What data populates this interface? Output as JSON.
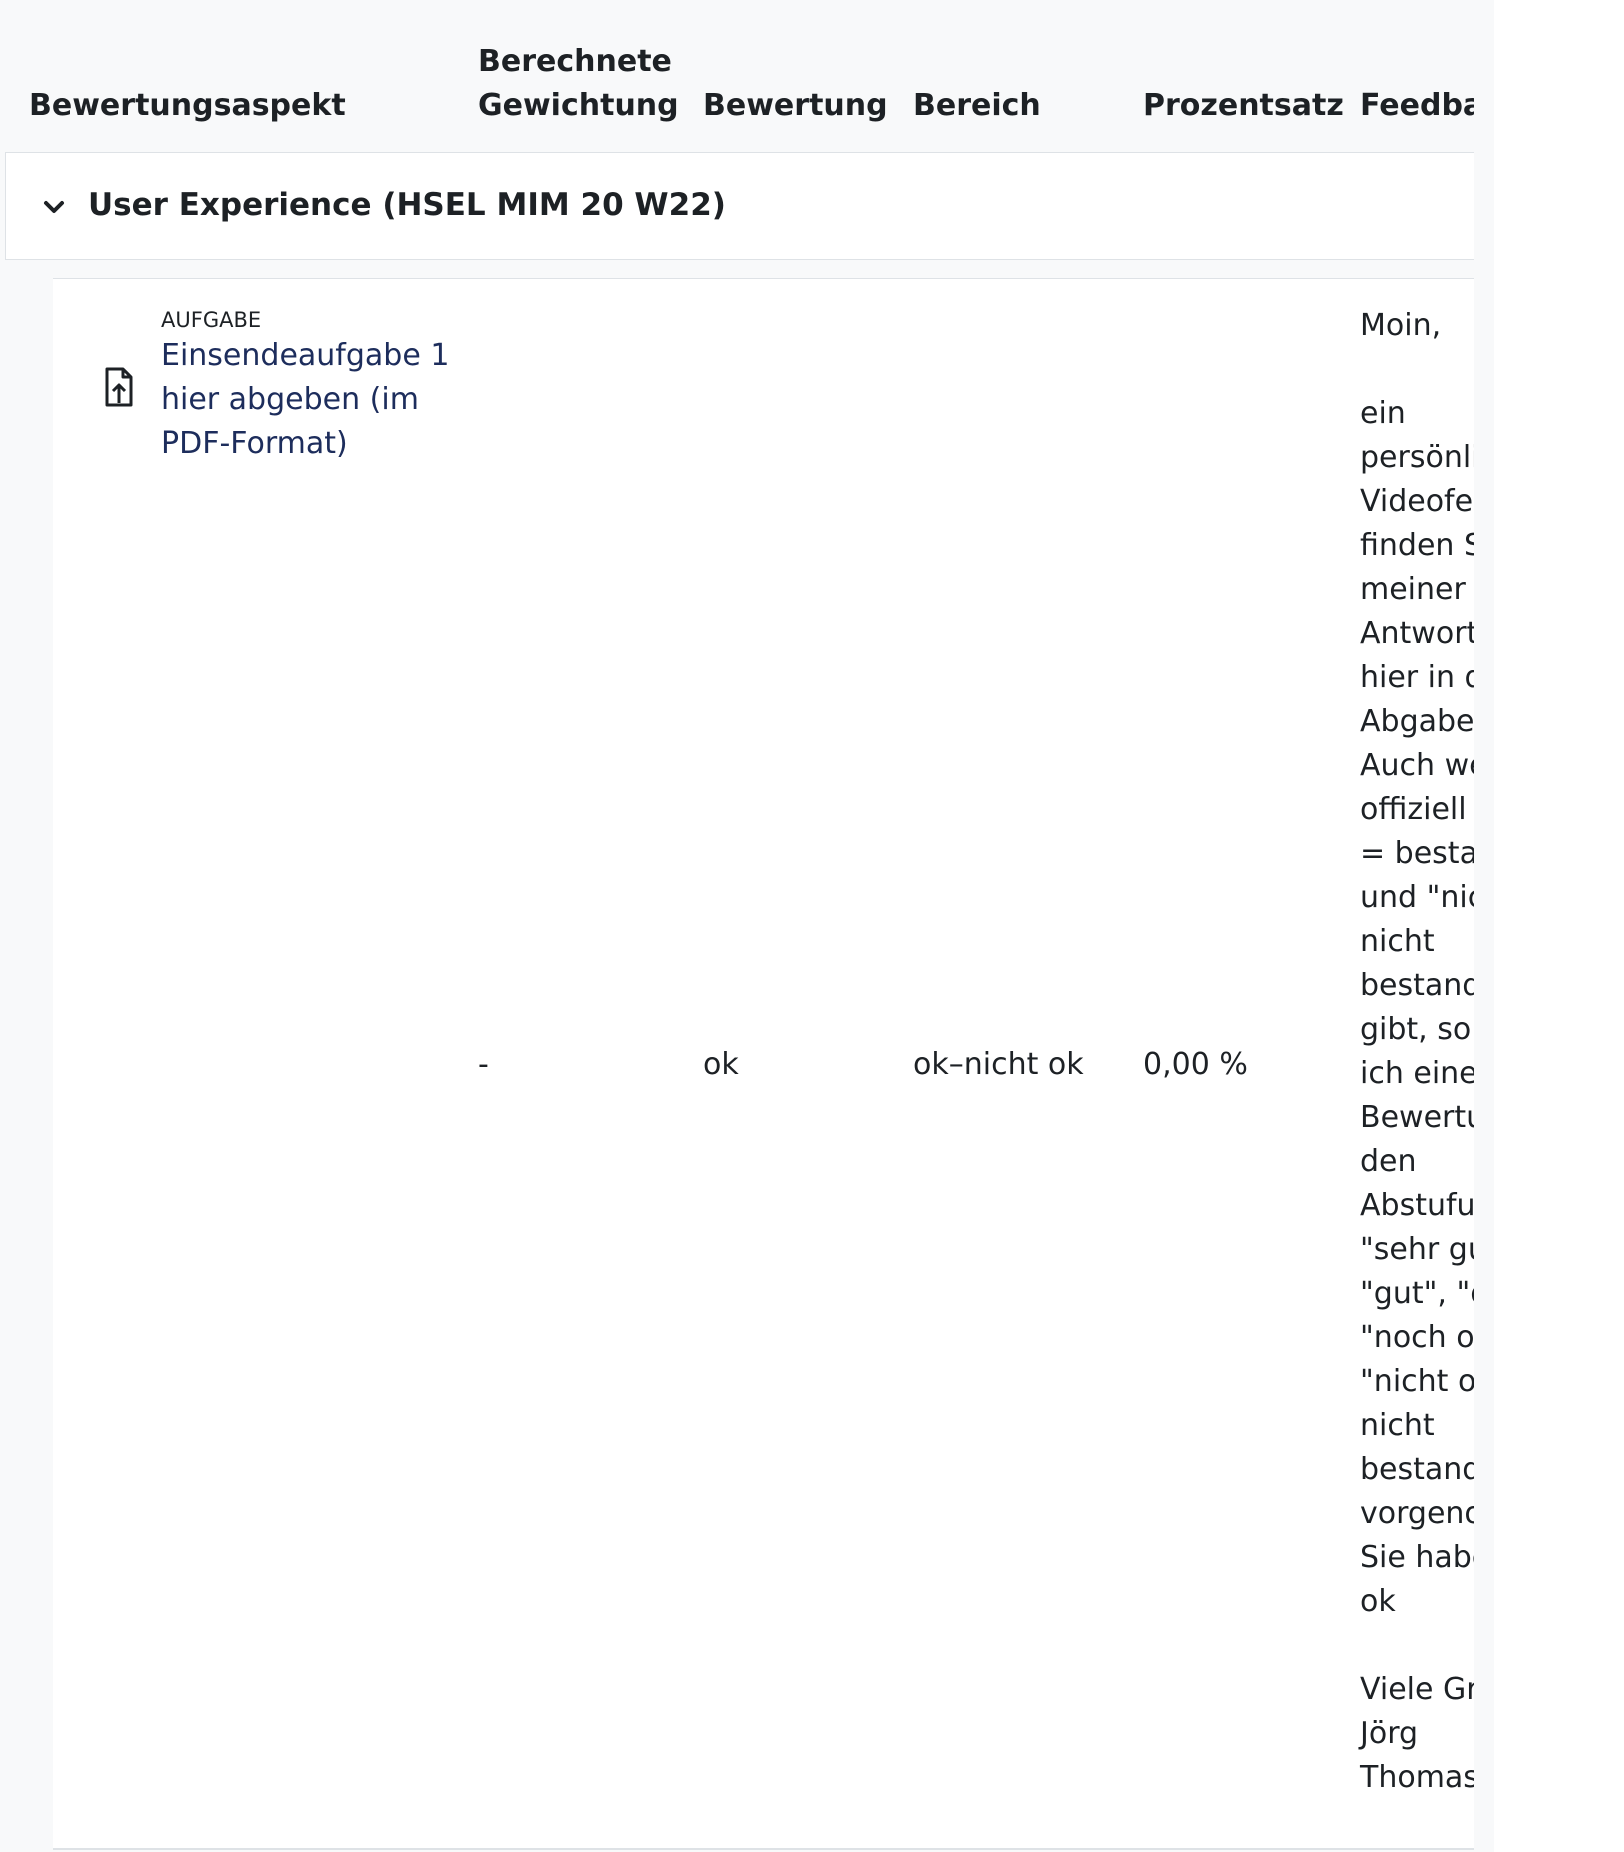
{
  "table": {
    "headers": {
      "item": "Bewertungsaspekt",
      "weight_line1": "Berechnete",
      "weight_line2": "Gewichtung",
      "grade": "Bewertung",
      "range": "Bereich",
      "percentage": "Prozentsatz",
      "feedback": "Feedback"
    },
    "category": {
      "title": "User Experience (HSEL MIM 20 W22)"
    },
    "item": {
      "module_type": "AUFGABE",
      "link_text": "Einsendeaufgabe 1 hier abgeben (im PDF-Format)",
      "weight": "-",
      "grade": "ok",
      "range": "ok–nicht ok",
      "percentage": "0,00 %",
      "feedback_greeting": "Moin,",
      "feedback_body": [
        "ein",
        "persönliches",
        "Videofeedback",
        "finden Sie in",
        "meiner",
        "Antwort",
        "hier in der",
        "Abgabe.",
        "Auch wenn es",
        "offiziell nur \"ok",
        "= bestanden\"",
        "und \"nicht ok =",
        "nicht",
        "bestanden\"",
        "gibt, so habe",
        "ich eine",
        "Bewertung in",
        "den",
        "Abstufungen",
        "\"sehr gut\",",
        "\"gut\", \"ok\",",
        "\"noch ok\",",
        "\"nicht ok =",
        "nicht",
        "bestanden\"",
        "vorgenommen.",
        "Sie haben:",
        "ok"
      ],
      "feedback_closing": [
        "Viele Grüße",
        "Jörg",
        "Thomaschewski"
      ]
    }
  }
}
